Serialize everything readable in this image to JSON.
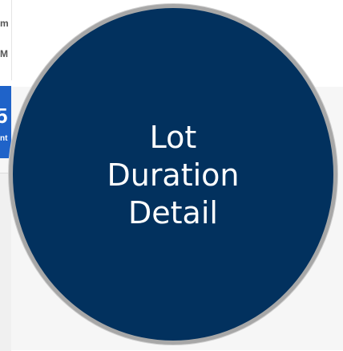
{
  "background": {
    "line_1": "m",
    "line_2": "M",
    "tile_big": "5",
    "tile_small": "nt"
  },
  "button": {
    "title_lines": [
      "Lot",
      "Duration",
      "Detail"
    ]
  },
  "colors": {
    "circle_fill": "#02315e",
    "circle_border": "#a7a7a7",
    "tile_blue": "#1f63c9"
  }
}
